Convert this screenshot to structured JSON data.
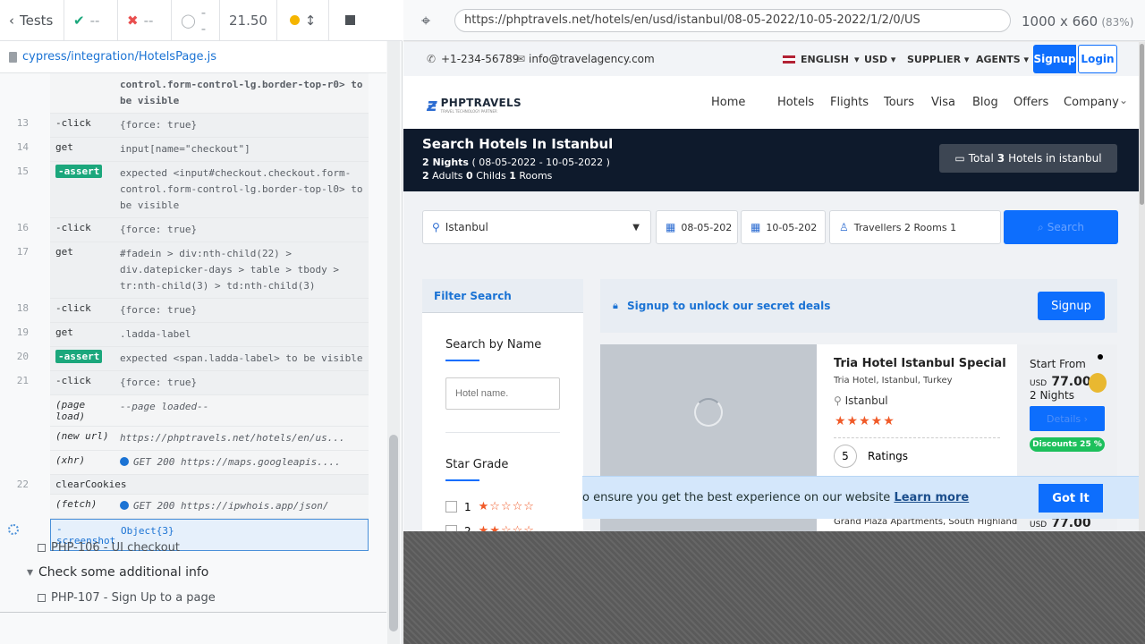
{
  "runner": {
    "tests_label": "Tests",
    "passed": "--",
    "failed": "--",
    "pending": "--",
    "duration": "21.50",
    "spec_path": "cypress/integration/HotelsPage.js"
  },
  "commands": [
    {
      "n": "",
      "cmd": "",
      "msg": "control.form-control-lg.border-top-r0> to be visible",
      "kind": "assertcont"
    },
    {
      "n": "13",
      "cmd": "-click",
      "msg": "{force: true}"
    },
    {
      "n": "14",
      "cmd": "get",
      "msg": "input[name=\"checkout\"]"
    },
    {
      "n": "15",
      "cmd": "-assert",
      "msg": "expected <input#checkout.checkout.form-control.form-control-lg.border-top-l0> to be visible",
      "kind": "assert"
    },
    {
      "n": "16",
      "cmd": "-click",
      "msg": "{force: true}"
    },
    {
      "n": "17",
      "cmd": "get",
      "msg": "#fadein > div:nth-child(22) > div.datepicker-days > table > tbody > tr:nth-child(3) > td:nth-child(3)"
    },
    {
      "n": "18",
      "cmd": "-click",
      "msg": "{force: true}"
    },
    {
      "n": "19",
      "cmd": "get",
      "msg": ".ladda-label"
    },
    {
      "n": "20",
      "cmd": "-assert",
      "msg": "expected <span.ladda-label> to be visible",
      "kind": "assert"
    },
    {
      "n": "21",
      "cmd": "-click",
      "msg": "{force: true}"
    },
    {
      "n": "",
      "cmd": "(page load)",
      "msg": "--page loaded--",
      "kind": "event"
    },
    {
      "n": "",
      "cmd": "(new url)",
      "msg": "https://phptravels.net/hotels/en/us...",
      "kind": "event"
    },
    {
      "n": "",
      "cmd": "(xhr)",
      "msg": "GET 200 https://maps.googleapis....",
      "kind": "eventdot"
    },
    {
      "n": "22",
      "cmd": "clearCookies",
      "msg": ""
    },
    {
      "n": "",
      "cmd": "(fetch)",
      "msg": "GET 200 https://ipwhois.app/json/",
      "kind": "eventdot"
    },
    {
      "n": "",
      "cmd": "-screenshot",
      "msg": "Object{3}",
      "kind": "active"
    }
  ],
  "tests": [
    {
      "label": "PHP-106 - UI checkout",
      "type": "test"
    },
    {
      "label": "Check some additional info",
      "type": "suite"
    },
    {
      "label": "PHP-107 - Sign Up to a page",
      "type": "test"
    }
  ],
  "browser": {
    "url": "https://phptravels.net/hotels/en/usd/istanbul/08-05-2022/10-05-2022/1/2/0/US",
    "viewport": "1000 x 660",
    "zoom": "(83%)"
  },
  "site": {
    "phone": "+1-234-56789",
    "email": "info@travelagency.com",
    "language": "ENGLISH",
    "currency": "USD",
    "supplier": "SUPPLIER",
    "agents": "AGENTS",
    "signup": "Signup",
    "login": "Login",
    "logo": "PHPTRAVELS",
    "logo_tag": "TRAVEL TECHNOLOGY PARTNER",
    "nav": [
      "Home",
      "Hotels",
      "Flights",
      "Tours",
      "Visa",
      "Blog",
      "Offers",
      "Company"
    ],
    "hero_title": "Search Hotels In Istanbul",
    "hero_nights": "2 Nights",
    "hero_dates": "( 08-05-2022 - 10-05-2022 )",
    "hero_guests_a": "2",
    "hero_guests_a_label": "Adults",
    "hero_guests_c": "0",
    "hero_guests_c_label": "Childs",
    "hero_guests_r": "1",
    "hero_guests_r_label": "Rooms",
    "total_label": "Total",
    "total_count": "3",
    "total_suffix": "Hotels in istanbul",
    "search_city": "Istanbul",
    "checkin": "08-05-202",
    "checkout": "10-05-202",
    "travellers": "Travellers 2 Rooms 1",
    "search_btn": "Search",
    "filter_title": "Filter Search",
    "search_by_name": "Search by Name",
    "hotel_placeholder": "Hotel name.",
    "star_grade": "Star Grade",
    "star1": "1",
    "star2": "2",
    "signup_deals": "Signup to unlock our secret deals",
    "signup_btn": "Signup",
    "hotel_name": "Tria Hotel Istanbul Special",
    "hotel_more": "...",
    "hotel_sub": "Tria Hotel, Istanbul, Turkey",
    "hotel_city": "Istanbul",
    "rating_num": "5",
    "rating_label": "Ratings",
    "start_from": "Start From",
    "price_cur": "USD",
    "price": "77.00",
    "nights": "2 Nights",
    "details": "Details",
    "discount": "Discounts 25 %",
    "next_hotel_sub": "Grand Plaza Apartments, South Highlander Wa",
    "next_price_cur": "USD",
    "next_price": "77.00",
    "cookie_text": "o ensure you get the best experience on our website",
    "cookie_link": "Learn more",
    "cookie_btn": "Got It"
  }
}
